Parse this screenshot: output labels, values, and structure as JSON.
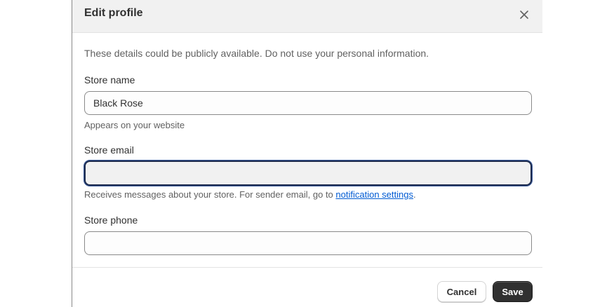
{
  "dialog": {
    "title": "Edit profile",
    "close_icon": "close-icon",
    "intro": "These details could be publicly available. Do not use your personal information."
  },
  "fields": {
    "store_name": {
      "label": "Store name",
      "value": "Black Rose",
      "help": "Appears on your website"
    },
    "store_email": {
      "label": "Store email",
      "value": "",
      "help_prefix": "Receives messages about your store. For sender email, go to ",
      "help_link": "notification settings",
      "help_suffix": "."
    },
    "store_phone": {
      "label": "Store phone",
      "value": ""
    }
  },
  "footer": {
    "cancel_label": "Cancel",
    "save_label": "Save"
  },
  "colors": {
    "link": "#005bd3",
    "primary_button": "#303030",
    "header_bg": "#f1f1f1"
  }
}
